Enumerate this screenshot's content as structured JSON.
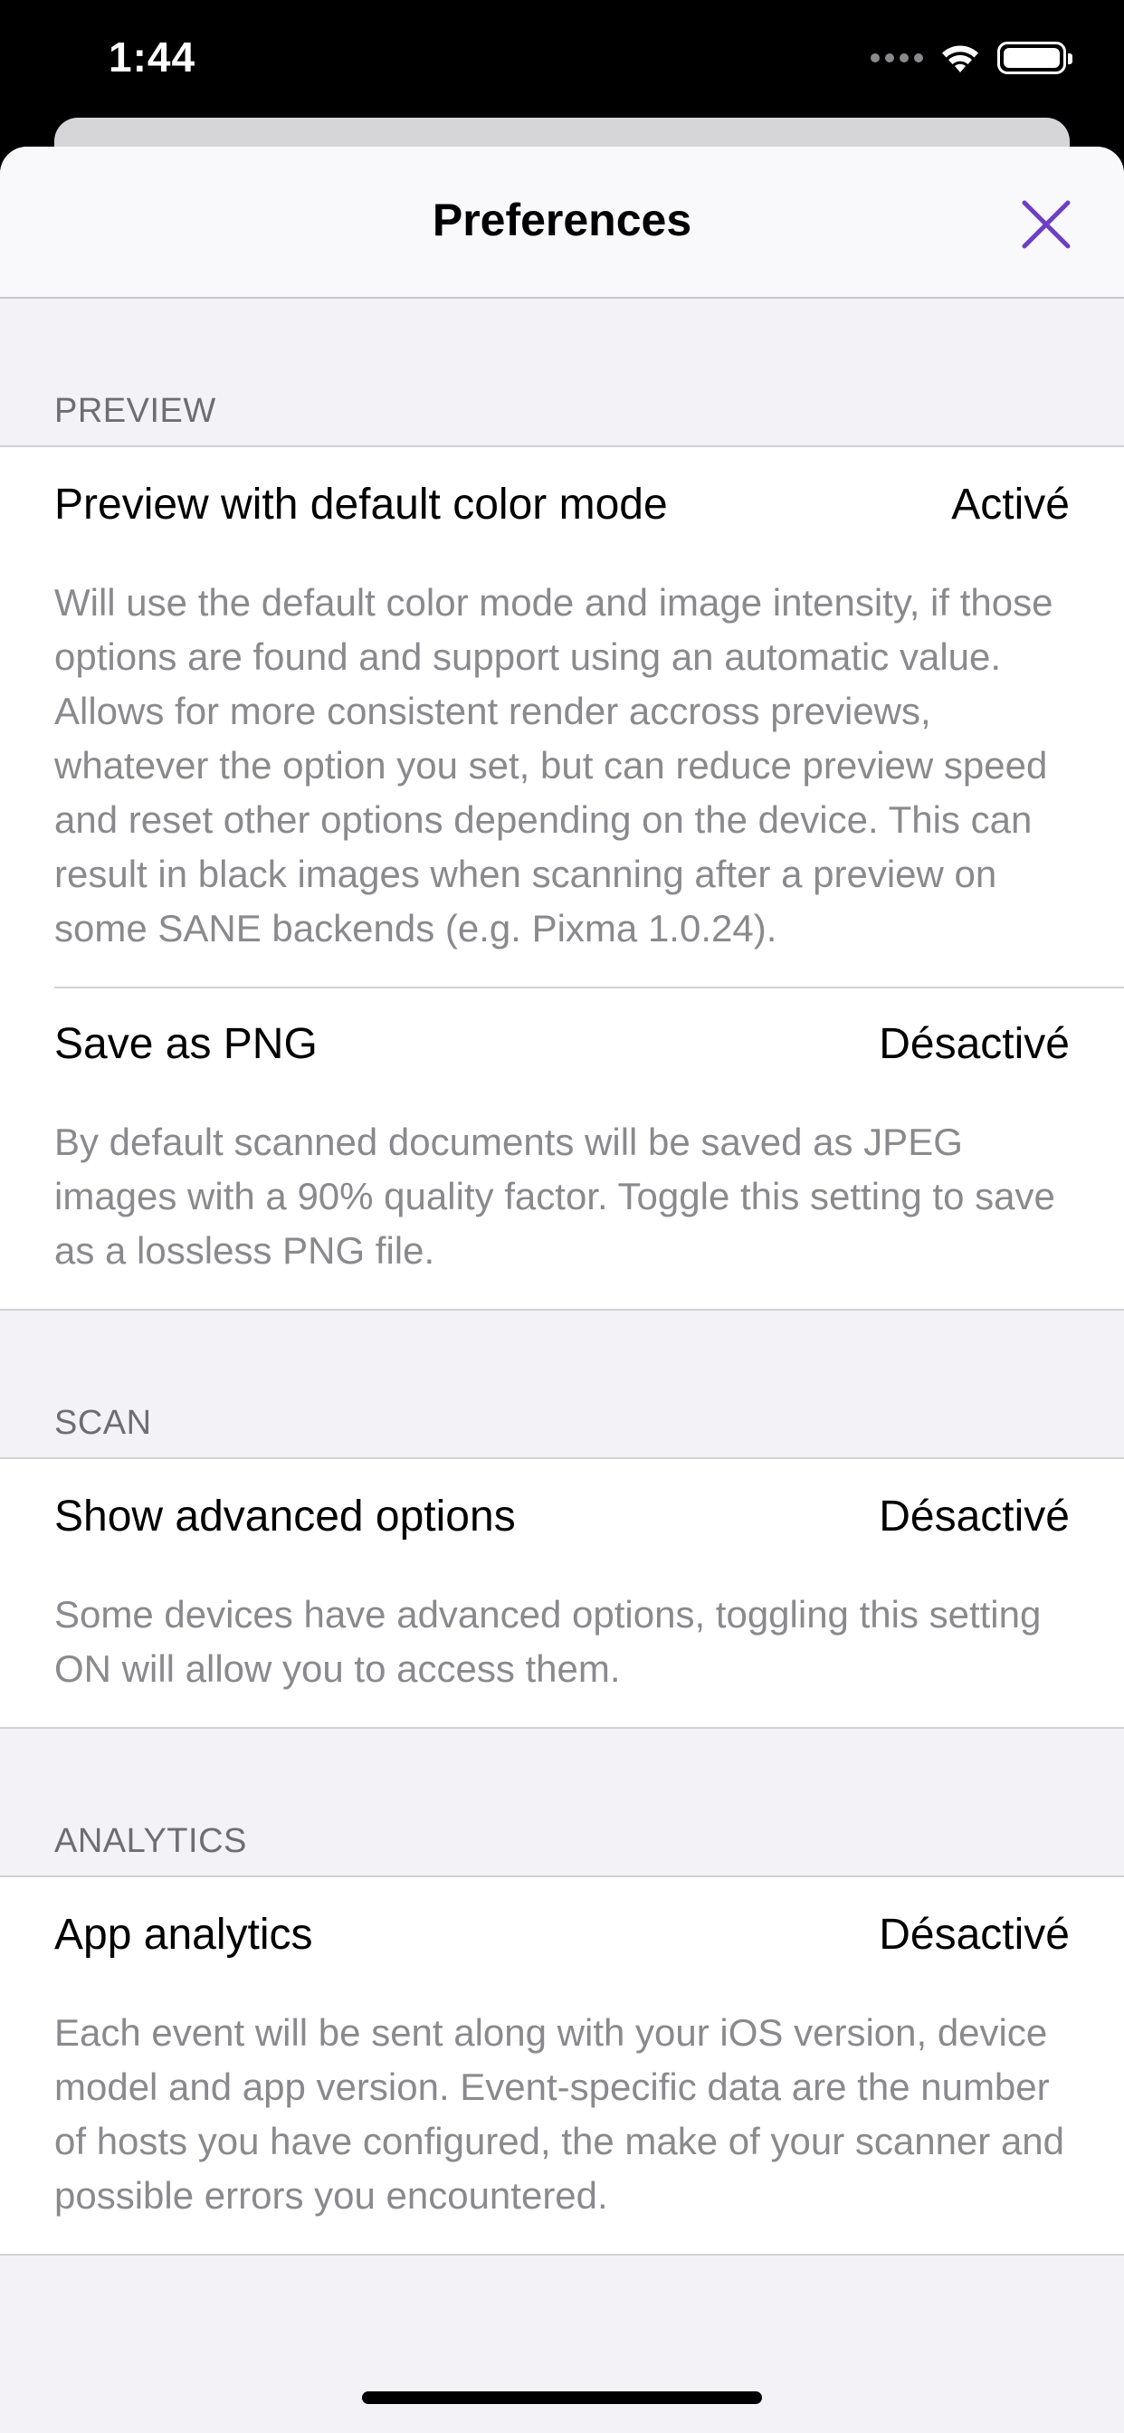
{
  "status_bar": {
    "time": "1:44"
  },
  "nav": {
    "title": "Preferences",
    "close_icon": "close-icon",
    "accent_color": "#6e3fc4"
  },
  "sections": [
    {
      "header": "PREVIEW",
      "cells": [
        {
          "title": "Preview with default color mode",
          "value": "Activé",
          "description": "Will use the default color mode and image intensity, if those options are found and support using an automatic value. Allows for more consistent render accross previews, whatever the option you set, but can reduce preview speed and reset other options depending on the device. This can result in black images when scanning after a preview on some SANE backends (e.g. Pixma 1.0.24)."
        },
        {
          "title": "Save as PNG",
          "value": "Désactivé",
          "description": "By default scanned documents will be saved as JPEG images with a 90% quality factor. Toggle this setting to save as a lossless PNG file."
        }
      ]
    },
    {
      "header": "SCAN",
      "cells": [
        {
          "title": "Show advanced options",
          "value": "Désactivé",
          "description": "Some devices have advanced options, toggling this setting ON will allow you to access them."
        }
      ]
    },
    {
      "header": "ANALYTICS",
      "cells": [
        {
          "title": "App analytics",
          "value": "Désactivé",
          "description": "Each event will be sent along with your iOS version, device model and app version. Event-specific data are the number of hosts you have configured, the make of your scanner and possible errors you encountered."
        }
      ]
    }
  ]
}
